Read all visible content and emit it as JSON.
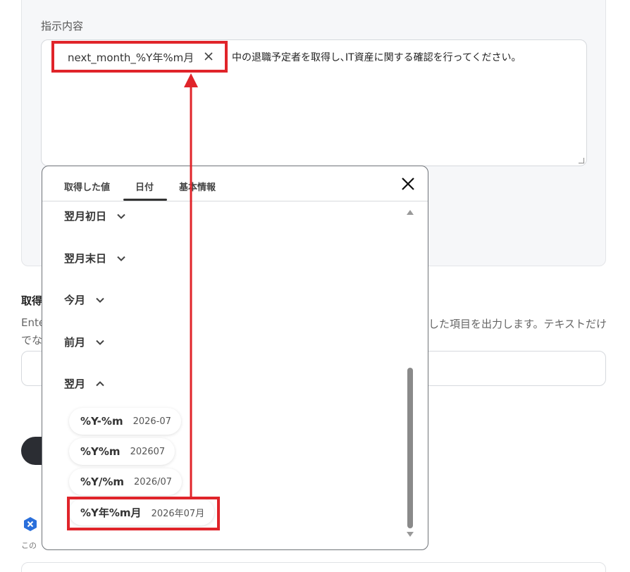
{
  "form": {
    "instruction_label": "指示内容",
    "variable_chip": "next_month_%Y年%m月",
    "prompt_text": "中の退職予定者を取得し､IT資産に関する確認を行ってください。",
    "section_title": "取得",
    "desc_line1_left": "Ente",
    "desc_line1_right": "した項目を出力します。テキストだけ",
    "desc_line2": "でな",
    "small_note": "この"
  },
  "popup": {
    "tabs": [
      {
        "label": "取得した値"
      },
      {
        "label": "日付",
        "active": true
      },
      {
        "label": "基本情報"
      }
    ],
    "groups": [
      {
        "label": "翌月初日",
        "expanded": false
      },
      {
        "label": "翌月末日",
        "expanded": false
      },
      {
        "label": "今月",
        "expanded": false
      },
      {
        "label": "前月",
        "expanded": false
      },
      {
        "label": "翌月",
        "expanded": true
      }
    ],
    "formats": [
      {
        "key": "%Y-%m",
        "value": "2026-07"
      },
      {
        "key": "%Y%m",
        "value": "202607"
      },
      {
        "key": "%Y/%m",
        "value": "2026/07"
      },
      {
        "key": "%Y年%m月",
        "value": "2026年07月"
      }
    ]
  },
  "colors": {
    "highlight": "#e0242a",
    "panel_bg": "#f6f7f9",
    "scroll_thumb": "#8a8a8a",
    "brand_icon": "#2a6fdb"
  },
  "icons": [
    "close-icon",
    "chevron-down-icon",
    "chevron-up-icon",
    "brand-icon"
  ]
}
